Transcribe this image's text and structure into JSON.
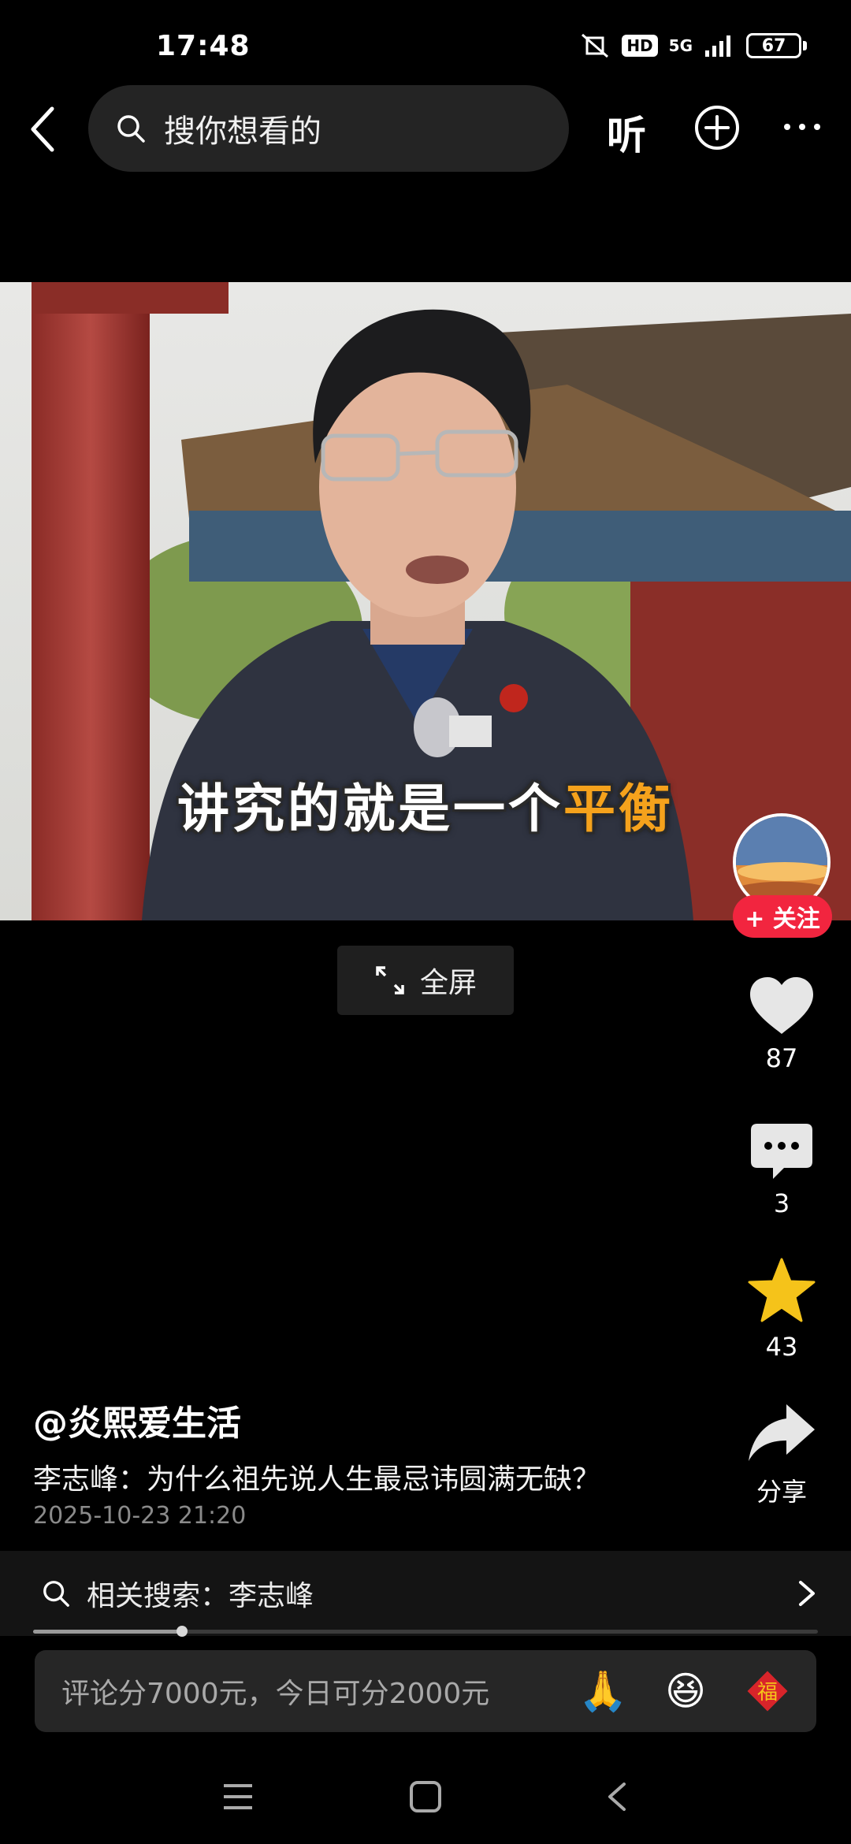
{
  "status_bar": {
    "time": "17:48",
    "hd": "HD",
    "network": "5G",
    "battery": "67"
  },
  "top_bar": {
    "search_placeholder": "搜你想看的",
    "listen_label": "听"
  },
  "video": {
    "caption_prefix": "讲究的就是一个",
    "caption_highlight": "平衡",
    "fullscreen_label": "全屏"
  },
  "rail": {
    "follow_label": "+ 关注",
    "likes": "87",
    "comments": "3",
    "favorites": "43",
    "share_label": "分享"
  },
  "post": {
    "author": "@炎熙爱生活",
    "title": "李志峰：为什么祖先说人生最忌讳圆满无缺？",
    "date": "2025-10-23 21:20"
  },
  "related_search": "相关搜索：李志峰",
  "progress": 0.19,
  "comment_bar": {
    "placeholder": "评论分7000元，今日可分2000元",
    "emojis": [
      "🙏",
      "😆",
      "福"
    ]
  },
  "colors": {
    "accent": "#f2253f",
    "star": "#f5c31a",
    "caption_highlight": "#f5a21c"
  }
}
